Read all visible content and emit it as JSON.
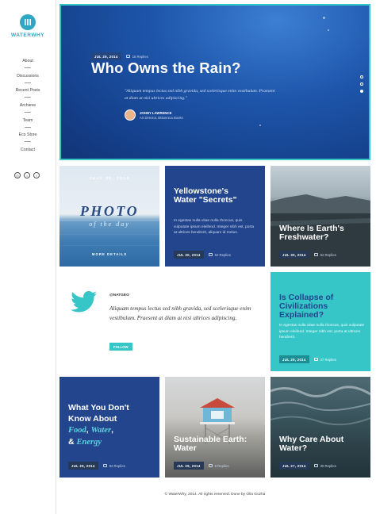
{
  "brand": {
    "name": "WATERWHY",
    "accent": "#2ea7c4",
    "teal": "#36c6c8",
    "navy": "#22458e"
  },
  "nav": {
    "items": [
      "About",
      "Discussions",
      "Recent Posts",
      "Archieve",
      "Team",
      "Eco Store",
      "Contact"
    ]
  },
  "social": {
    "icons": [
      "dribbble-icon",
      "twitter-icon",
      "facebook-icon"
    ]
  },
  "hero": {
    "date": "JUL 29, 2014",
    "replies": "16 Replies",
    "title": "Who Owns the Rain?",
    "quote": "\"Aliquam tempus lectus sed nibh gravida, sed scelerisque enim vestibulum. Praesent at diam at nisi ultrices adipiscing.\"",
    "author_name": "JOHNY LAWRENCE",
    "author_role": "Art Director, Britannica Books"
  },
  "tiles": {
    "photo": {
      "date": "JULY 30, 2014",
      "big": "PHOTO",
      "small": "of the day",
      "more": "MORE DETAILS"
    },
    "yellowstone": {
      "title": "Yellowstone's Water \"Secrets\"",
      "body": "In egestas nulla vitae nulla rhoncus, quis vulputate ipsum eleifend. Integer nibh est, porta at ultrices hendrerit, aliquam id metus.",
      "date": "JUL 30, 2014",
      "replies": "62 Replies"
    },
    "fresh": {
      "title": "Where Is Earth's Freshwater?",
      "date": "JUL 30, 2014",
      "replies": "52 Replies"
    },
    "twitter": {
      "handle": "@NATGEO",
      "text": "Aliquam tempus lectus sed nibh gravida, sed scelerisque enim vestibulum. Praesent at diam at nisi ultrices adipiscing.",
      "follow": "FOLLOW"
    },
    "collapse": {
      "title": "Is Collapse of Civilizations Explained?",
      "body": "In egestas nulla vitae nulla rhoncus, quis vulputate ipsum eleifend. Integer nibh est, porta at ultrices hendrerit.",
      "date": "JUL 29, 2014",
      "replies": "27 Replies"
    },
    "food": {
      "title_line1": "What You Don't",
      "title_line2": "Know About",
      "em_food": "Food",
      "comma1": ",",
      "em_water": "Water",
      "comma2": ",",
      "amp": "&",
      "em_energy": "Energy",
      "date": "JUL 29, 2014",
      "replies": "82 Replies"
    },
    "sustainable": {
      "title": "Sustainable Earth: Water",
      "date": "JUL 29, 2014",
      "replies": "6 Replies"
    },
    "why": {
      "title": "Why Care About Water?",
      "date": "JUL 27, 2014",
      "replies": "30 Replies"
    }
  },
  "footer": {
    "text": "© WaterWhy, 2014. All rights reserved. Done by Olia Gozha"
  }
}
